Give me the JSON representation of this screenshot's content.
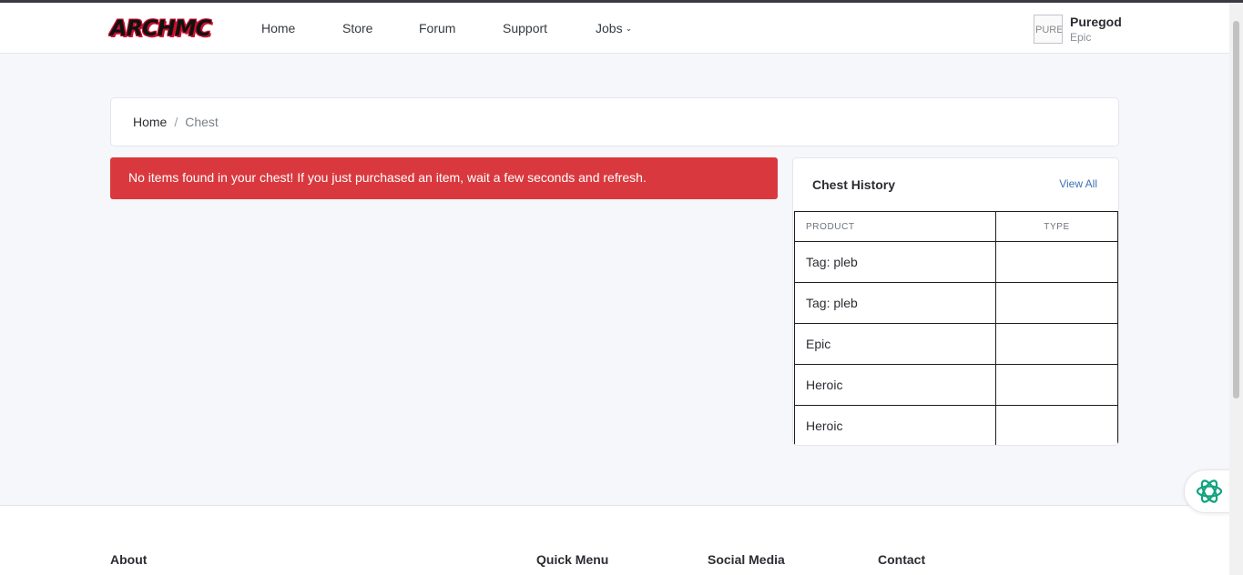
{
  "navbar": {
    "logo_text": "ARCHMC",
    "links": [
      "Home",
      "Store",
      "Forum",
      "Support",
      "Jobs"
    ],
    "user": {
      "avatar_alt": "PUREGOD",
      "name": "Puregod",
      "rank": "Epic"
    }
  },
  "breadcrumb": {
    "home": "Home",
    "separator": "/",
    "current": "Chest"
  },
  "alert": {
    "message": "No items found in your chest! If you just purchased an item, wait a few seconds and refresh."
  },
  "chest_history": {
    "title": "Chest History",
    "view_all": "View All",
    "columns": [
      "PRODUCT",
      "TYPE"
    ],
    "rows": [
      {
        "product": "Tag: pleb",
        "type": ""
      },
      {
        "product": "Tag: pleb",
        "type": ""
      },
      {
        "product": "Epic",
        "type": ""
      },
      {
        "product": "Heroic",
        "type": ""
      },
      {
        "product": "Heroic",
        "type": ""
      }
    ]
  },
  "footer": {
    "headings": [
      "About",
      "Quick Menu",
      "Social Media",
      "Contact"
    ]
  },
  "colors": {
    "alert_bg": "#d9393e",
    "link": "#3b6fb6",
    "page_bg": "#f6f7fb",
    "assistant_icon": "#10a37f"
  },
  "icons": {
    "jobs_dropdown": "chevron-down-icon",
    "assistant": "openai-assistant-icon"
  }
}
